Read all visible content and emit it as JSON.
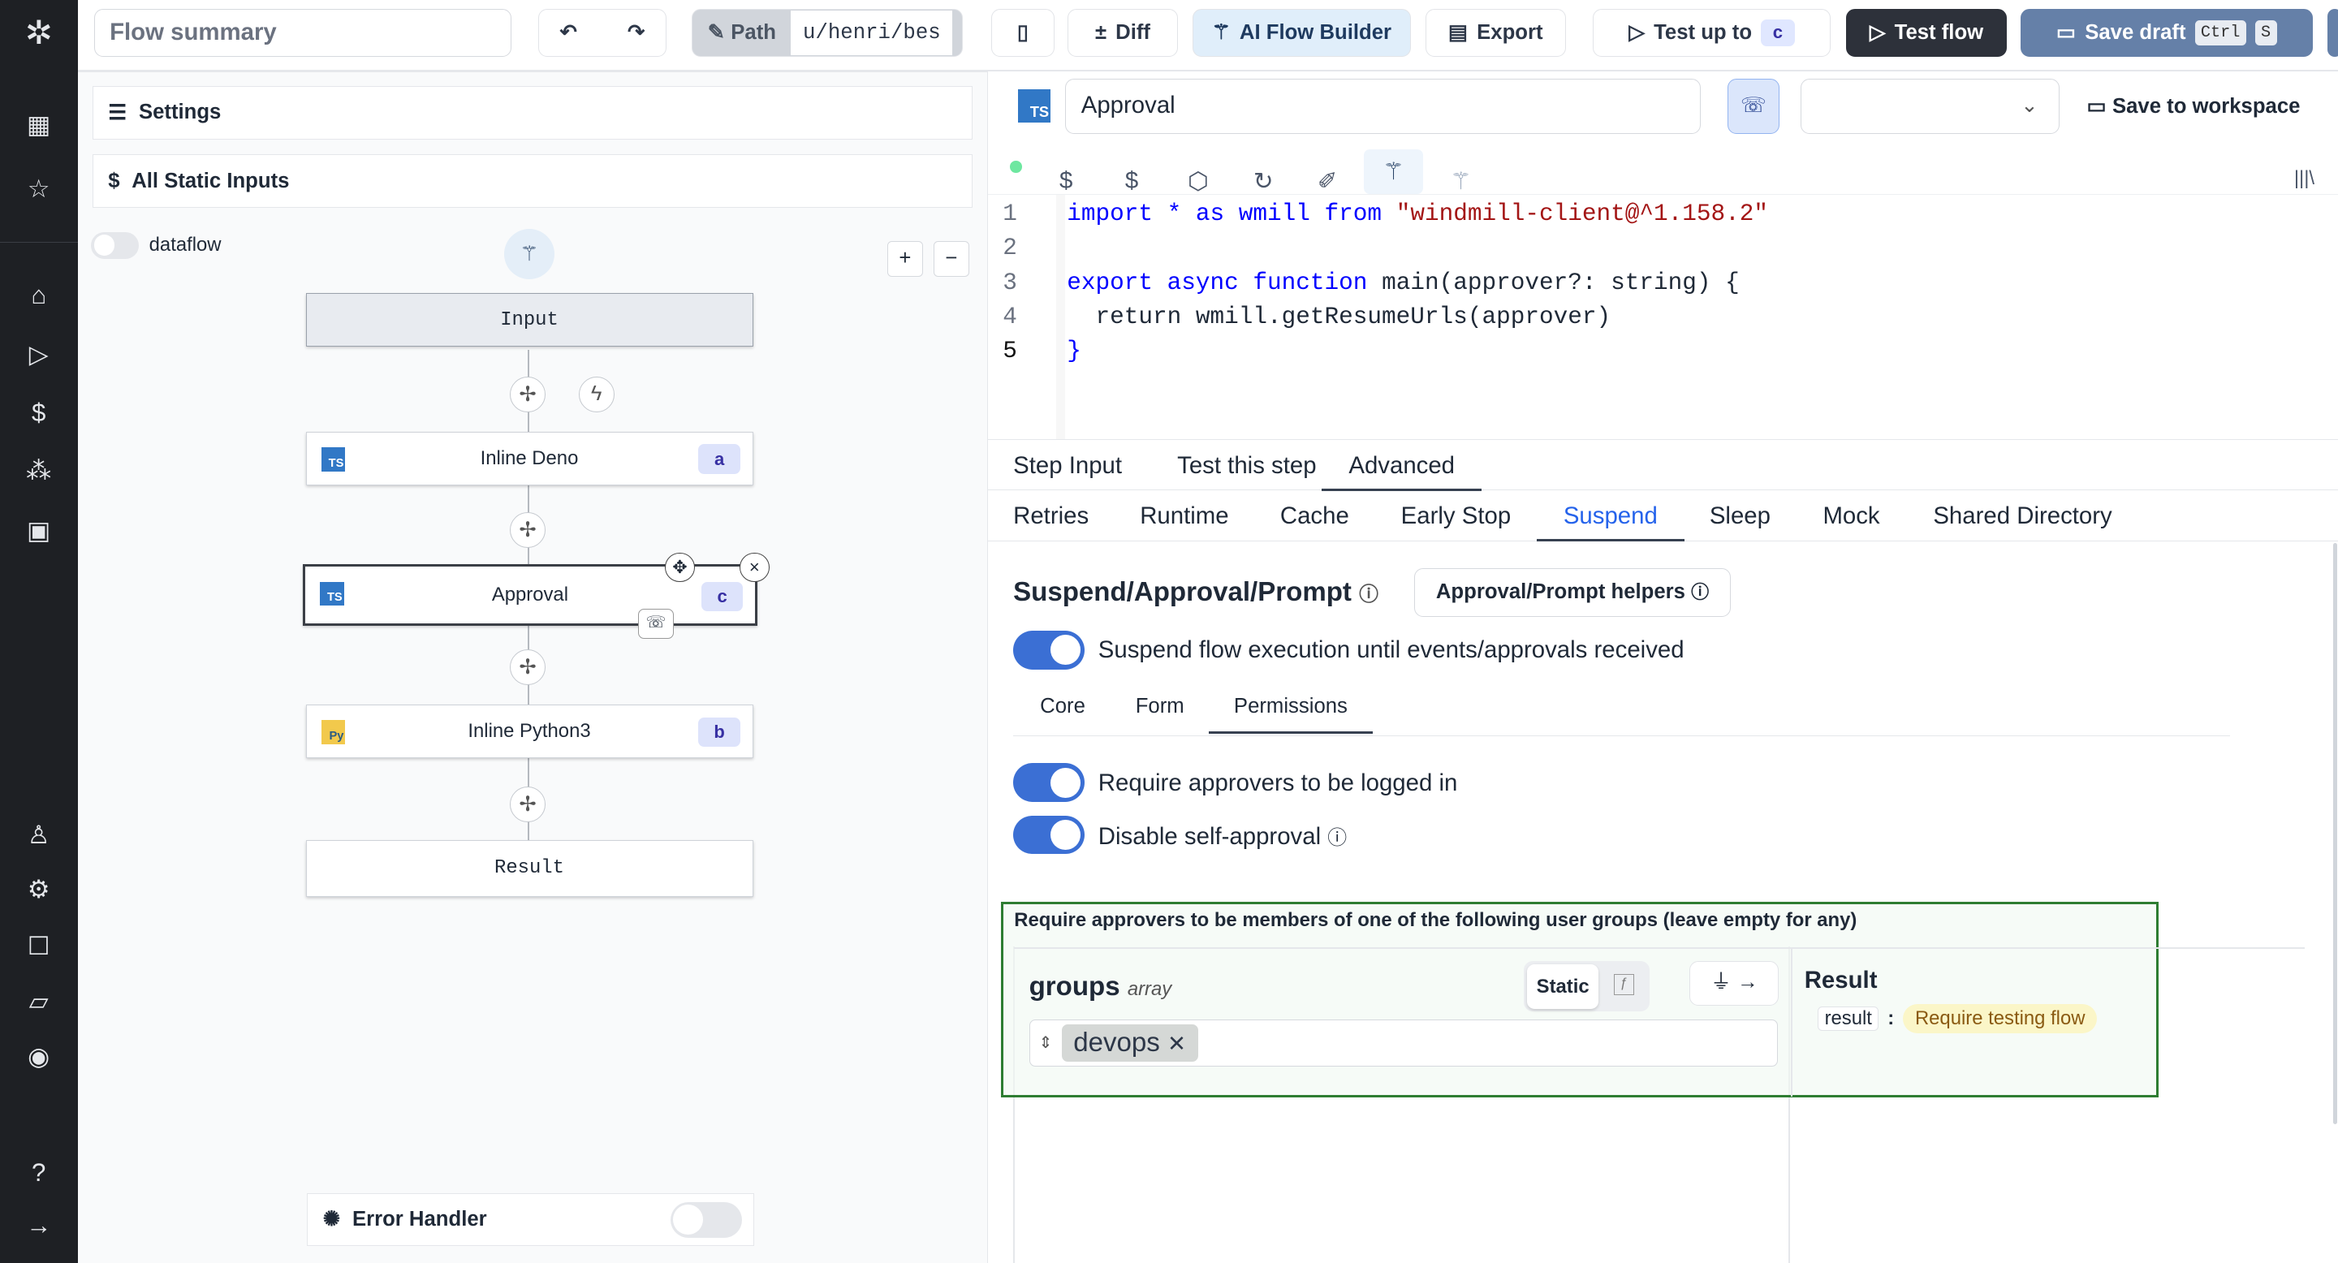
{
  "topbar": {
    "summary_placeholder": "Flow summary",
    "path_label": "Path",
    "path_value": "u/henri/bes",
    "diff": "Diff",
    "ai_flow_builder": "AI Flow Builder",
    "export": "Export",
    "test_up_to": "Test up to",
    "test_up_to_step": "c",
    "test_flow": "Test flow",
    "save_draft": "Save draft",
    "kbd_ctrl": "Ctrl",
    "kbd_s": "S"
  },
  "left": {
    "settings": "Settings",
    "static_inputs": "All Static Inputs",
    "dataflow": "dataflow",
    "error_handler": "Error Handler",
    "nodes": [
      {
        "label": "Input"
      },
      {
        "label": "Inline Deno",
        "id": "a"
      },
      {
        "label": "Approval",
        "id": "c"
      },
      {
        "label": "Inline Python3",
        "id": "b"
      },
      {
        "label": "Result"
      }
    ]
  },
  "editor": {
    "step_name": "Approval",
    "save_to_workspace": "Save to workspace",
    "lines": [
      [
        "import * as wmill ",
        "from ",
        "\"windmill-client@^1.158.2\""
      ],
      [
        ""
      ],
      [
        "export async function ",
        "main(approver?: string) {"
      ],
      [
        "  return wmill.getResumeUrls(approver)"
      ],
      [
        "}"
      ]
    ]
  },
  "tabs": {
    "main": [
      "Step Input",
      "Test this step",
      "Advanced"
    ],
    "active_main": "Advanced",
    "advanced": [
      "Retries",
      "Runtime",
      "Cache",
      "Early Stop",
      "Suspend",
      "Sleep",
      "Mock",
      "Shared Directory"
    ],
    "active_advanced": "Suspend"
  },
  "suspend": {
    "title": "Suspend/Approval/Prompt",
    "helpers": "Approval/Prompt helpers",
    "suspend_toggle": "Suspend flow execution until events/approvals received",
    "suspend_on": true,
    "subtabs": [
      "Core",
      "Form",
      "Permissions"
    ],
    "active_subtab": "Permissions",
    "require_login": "Require approvers to be logged in",
    "require_login_on": true,
    "self_approval": "Disable self-approval",
    "self_approval_on": true,
    "groups_note": "Require approvers to be members of one of the following user groups (leave empty for any)",
    "groups_label": "groups",
    "groups_type": "array",
    "static": "Static",
    "groups_values": [
      "devops"
    ],
    "result_title": "Result",
    "result_key": "result",
    "result_value": "Require testing flow"
  },
  "colors": {
    "accent": "#3b6fd4",
    "sidebar": "#1e2024",
    "highlight_border": "#2e7d32"
  }
}
